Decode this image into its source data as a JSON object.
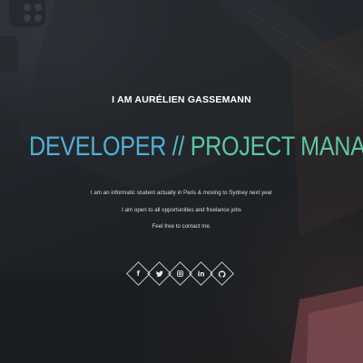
{
  "hero": {
    "intro": "I AM AURÉLIEN GASSEMANN",
    "headline": {
      "part1": "DEVELOPER",
      "separator": " // ",
      "part2": "PROJECT MANAGER"
    },
    "description": [
      "I am an informatic student actually in Paris & moving to Sydney next year",
      "I am open to all opportunities and freelance jobs",
      "Feel free to contact me."
    ]
  },
  "social": [
    {
      "icon": "facebook-icon",
      "glyph": "f"
    },
    {
      "icon": "twitter-icon",
      "glyph": ""
    },
    {
      "icon": "instagram-icon",
      "glyph": ""
    },
    {
      "icon": "linkedin-icon",
      "glyph": "in"
    },
    {
      "icon": "github-icon",
      "glyph": ""
    }
  ],
  "colors": {
    "accent_blue": "#4fb0d6",
    "accent_green": "#5cc7a3",
    "background": "#22262b"
  }
}
